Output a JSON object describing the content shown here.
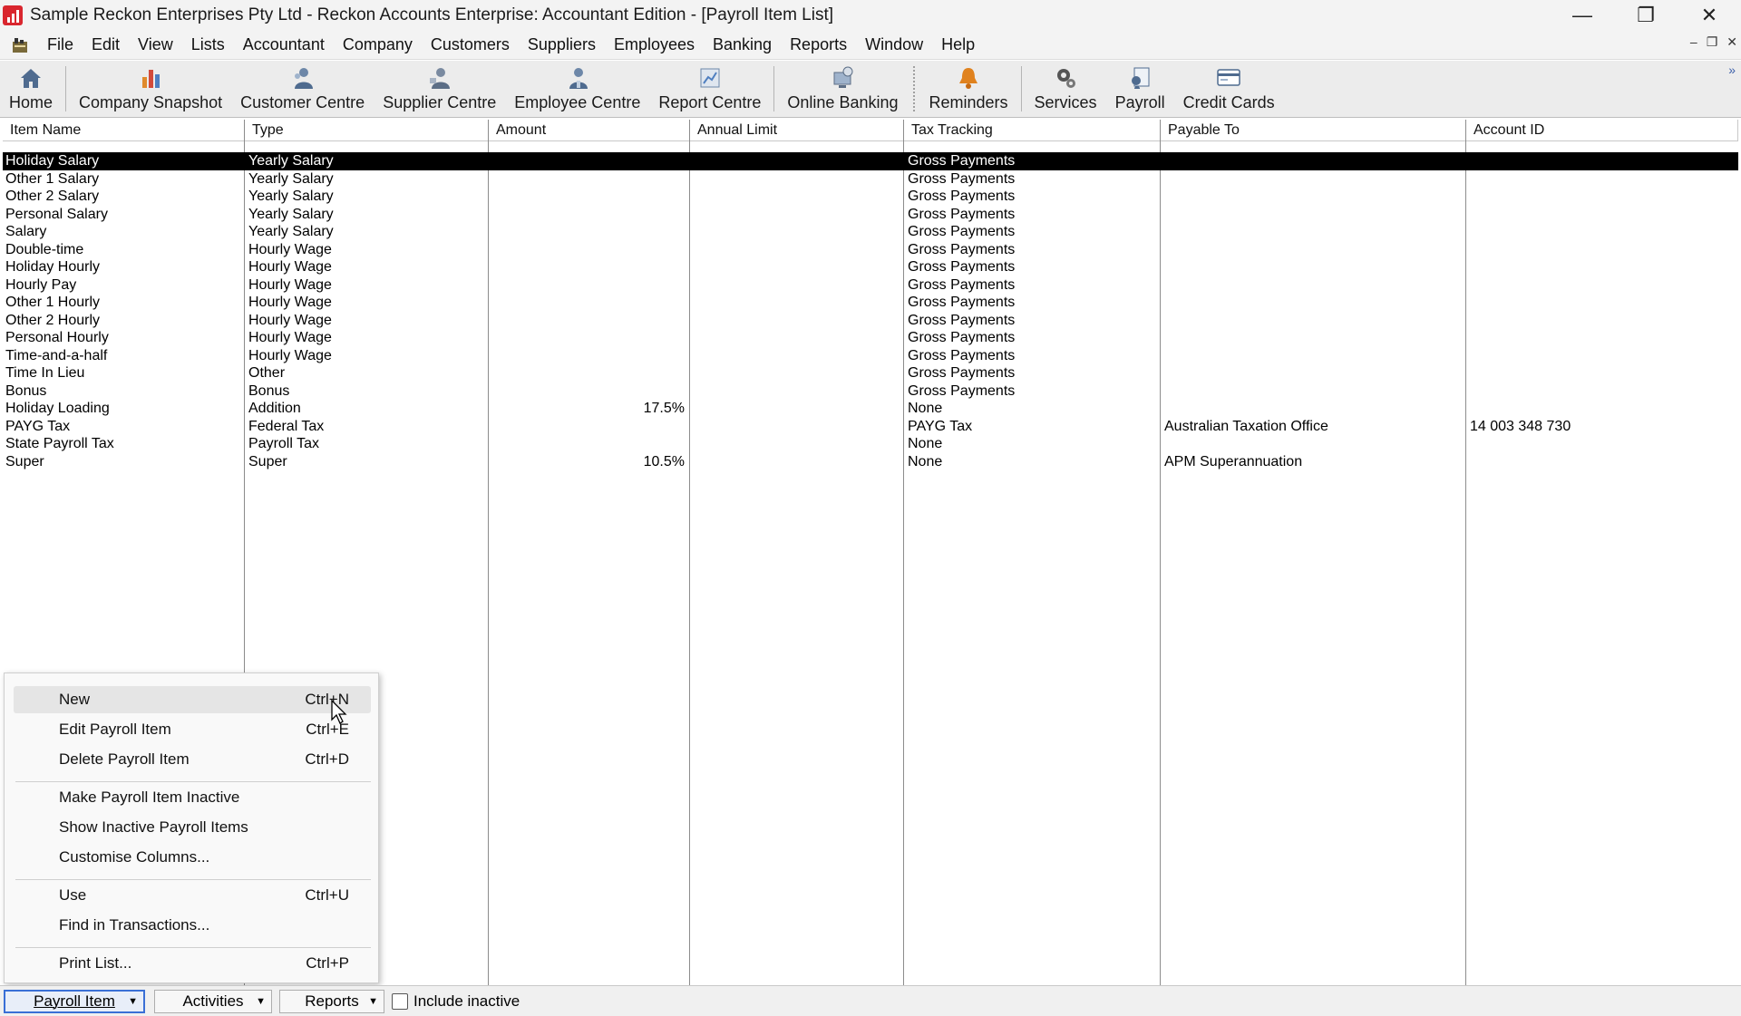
{
  "window": {
    "title": "Sample Reckon Enterprises Pty Ltd - Reckon Accounts Enterprise: Accountant Edition - [Payroll Item List]",
    "controls": [
      "minimize",
      "restore",
      "close"
    ],
    "minimize_glyph": "—",
    "restore_glyph": "❐",
    "close_glyph": "✕"
  },
  "menubar": {
    "items": [
      "File",
      "Edit",
      "View",
      "Lists",
      "Accountant",
      "Company",
      "Customers",
      "Suppliers",
      "Employees",
      "Banking",
      "Reports",
      "Window",
      "Help"
    ],
    "mdi": {
      "minimize": "‒",
      "restore": "❐",
      "close": "✕"
    }
  },
  "toolbar": {
    "buttons": [
      {
        "label": "Home",
        "icon": "home-icon"
      },
      {
        "label": "Company Snapshot",
        "icon": "bar-chart-icon"
      },
      {
        "label": "Customer Centre",
        "icon": "customer-centre-icon"
      },
      {
        "label": "Supplier Centre",
        "icon": "supplier-centre-icon"
      },
      {
        "label": "Employee Centre",
        "icon": "employee-centre-icon"
      },
      {
        "label": "Report Centre",
        "icon": "report-centre-icon"
      },
      {
        "label": "Online Banking",
        "icon": "online-banking-icon"
      },
      {
        "label": "Reminders",
        "icon": "bell-icon"
      },
      {
        "label": "Services",
        "icon": "gear-icon"
      },
      {
        "label": "Payroll",
        "icon": "payroll-icon"
      },
      {
        "label": "Credit Cards",
        "icon": "credit-card-icon"
      }
    ],
    "overflow": "»"
  },
  "table": {
    "columns": [
      "Item Name",
      "Type",
      "Amount",
      "Annual Limit",
      "Tax Tracking",
      "Payable To",
      "Account ID"
    ],
    "rows": [
      {
        "name": "Holiday Salary",
        "type": "Yearly Salary",
        "amount": "",
        "limit": "",
        "tax": "Gross Payments",
        "payable": "",
        "account": "",
        "selected": true
      },
      {
        "name": "Other 1 Salary",
        "type": "Yearly Salary",
        "amount": "",
        "limit": "",
        "tax": "Gross Payments",
        "payable": "",
        "account": ""
      },
      {
        "name": "Other 2 Salary",
        "type": "Yearly Salary",
        "amount": "",
        "limit": "",
        "tax": "Gross Payments",
        "payable": "",
        "account": ""
      },
      {
        "name": "Personal Salary",
        "type": "Yearly Salary",
        "amount": "",
        "limit": "",
        "tax": "Gross Payments",
        "payable": "",
        "account": ""
      },
      {
        "name": "Salary",
        "type": "Yearly Salary",
        "amount": "",
        "limit": "",
        "tax": "Gross Payments",
        "payable": "",
        "account": ""
      },
      {
        "name": "Double-time",
        "type": "Hourly Wage",
        "amount": "",
        "limit": "",
        "tax": "Gross Payments",
        "payable": "",
        "account": ""
      },
      {
        "name": "Holiday Hourly",
        "type": "Hourly Wage",
        "amount": "",
        "limit": "",
        "tax": "Gross Payments",
        "payable": "",
        "account": ""
      },
      {
        "name": "Hourly Pay",
        "type": "Hourly Wage",
        "amount": "",
        "limit": "",
        "tax": "Gross Payments",
        "payable": "",
        "account": ""
      },
      {
        "name": "Other 1 Hourly",
        "type": "Hourly Wage",
        "amount": "",
        "limit": "",
        "tax": "Gross Payments",
        "payable": "",
        "account": ""
      },
      {
        "name": "Other 2 Hourly",
        "type": "Hourly Wage",
        "amount": "",
        "limit": "",
        "tax": "Gross Payments",
        "payable": "",
        "account": ""
      },
      {
        "name": "Personal Hourly",
        "type": "Hourly Wage",
        "amount": "",
        "limit": "",
        "tax": "Gross Payments",
        "payable": "",
        "account": ""
      },
      {
        "name": "Time-and-a-half",
        "type": "Hourly Wage",
        "amount": "",
        "limit": "",
        "tax": "Gross Payments",
        "payable": "",
        "account": ""
      },
      {
        "name": "Time In Lieu",
        "type": "Other",
        "amount": "",
        "limit": "",
        "tax": "Gross Payments",
        "payable": "",
        "account": ""
      },
      {
        "name": "Bonus",
        "type": "Bonus",
        "amount": "",
        "limit": "",
        "tax": "Gross Payments",
        "payable": "",
        "account": ""
      },
      {
        "name": "Holiday Loading",
        "type": "Addition",
        "amount": "17.5%",
        "limit": "",
        "tax": "None",
        "payable": "",
        "account": ""
      },
      {
        "name": "PAYG Tax",
        "type": "Federal Tax",
        "amount": "",
        "limit": "",
        "tax": "PAYG Tax",
        "payable": "Australian Taxation Office",
        "account": "14 003 348 730"
      },
      {
        "name": "State Payroll Tax",
        "type": "Payroll Tax",
        "amount": "",
        "limit": "",
        "tax": "None",
        "payable": "",
        "account": ""
      },
      {
        "name": "Super",
        "type": "Super",
        "amount": "10.5%",
        "limit": "",
        "tax": "None",
        "payable": "APM Superannuation",
        "account": ""
      }
    ]
  },
  "context_menu": {
    "groups": [
      [
        {
          "label": "New",
          "shortcut": "Ctrl+N",
          "hover": true
        },
        {
          "label": "Edit Payroll Item",
          "shortcut": "Ctrl+E"
        },
        {
          "label": "Delete Payroll Item",
          "shortcut": "Ctrl+D"
        }
      ],
      [
        {
          "label": "Make Payroll Item Inactive",
          "shortcut": ""
        },
        {
          "label": "Show Inactive Payroll Items",
          "shortcut": ""
        },
        {
          "label": "Customise Columns...",
          "shortcut": ""
        }
      ],
      [
        {
          "label": "Use",
          "shortcut": "Ctrl+U"
        },
        {
          "label": "Find in Transactions...",
          "shortcut": ""
        }
      ],
      [
        {
          "label": "Print List...",
          "shortcut": "Ctrl+P"
        }
      ]
    ]
  },
  "bottombar": {
    "payroll_item": "Payroll Item",
    "activities": "Activities",
    "reports": "Reports",
    "include_inactive": "Include inactive",
    "include_inactive_checked": false,
    "dropdown_glyph": "▼"
  }
}
